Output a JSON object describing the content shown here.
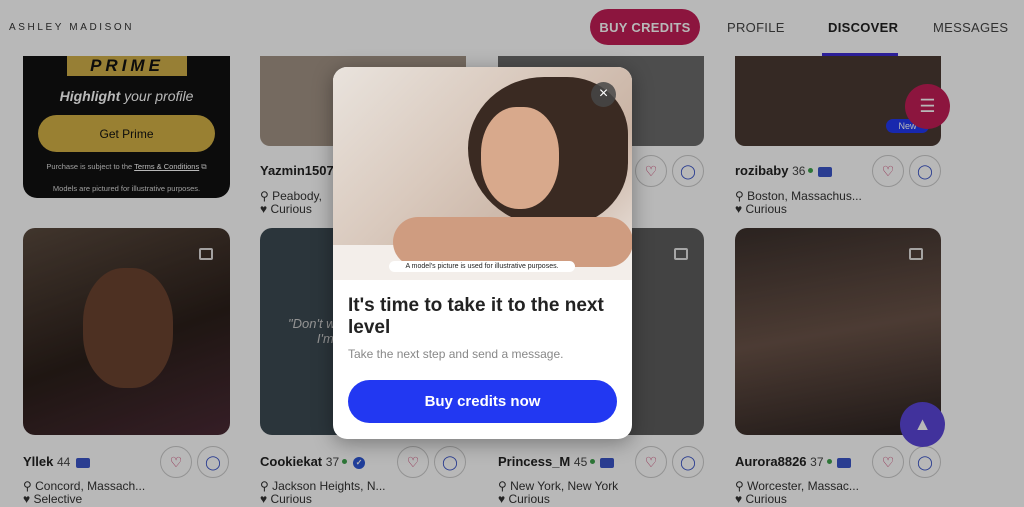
{
  "header": {
    "brand": "ASHLEY MADISON",
    "buy_credits": "BUY CREDITS",
    "nav": [
      "PROFILE",
      "DISCOVER",
      "MESSAGES"
    ]
  },
  "prime_card": {
    "word": "PRIME",
    "highlight_bold": "Highlight",
    "highlight_rest": " your profile",
    "button": "Get Prime",
    "fine1_pre": "Purchase is subject to the ",
    "fine1_link": "Terms & Conditions",
    "fine2": "Models are pictured for illustrative purposes."
  },
  "profiles": [
    {
      "name": "Yazmin1507",
      "location": "Peabody,",
      "intent": "Curious"
    },
    {
      "name": "rozibaby",
      "age": "36",
      "location": "Boston, Massachus...",
      "intent": "Curious",
      "badge": "New"
    },
    {
      "name": "Yllek",
      "age": "44",
      "location": "Concord, Massach...",
      "intent": "Selective"
    },
    {
      "name": "Cookiekat",
      "age": "37",
      "location": "Jackson Heights, N...",
      "intent": "Curious",
      "quote": "\"Don't w",
      "quote2": "I'm s"
    },
    {
      "name": "Princess_M",
      "age": "45",
      "location": "New York, New York",
      "intent": "Curious"
    },
    {
      "name": "Aurora8826",
      "age": "37",
      "location": "Worcester, Massac...",
      "intent": "Curious"
    }
  ],
  "modal": {
    "image_note": "A model's picture is used for illustrative purposes.",
    "title": "It's time to take it to the next level",
    "subtitle": "Take the next step and send a message.",
    "button": "Buy credits now"
  },
  "icons": [
    "close-icon",
    "heart-icon",
    "chat-icon",
    "location-icon",
    "filter-icon",
    "rocket-icon",
    "gallery-icon"
  ],
  "colors": {
    "accent": "#c21e56",
    "primary": "#2238f2",
    "gold": "#d4b246"
  }
}
